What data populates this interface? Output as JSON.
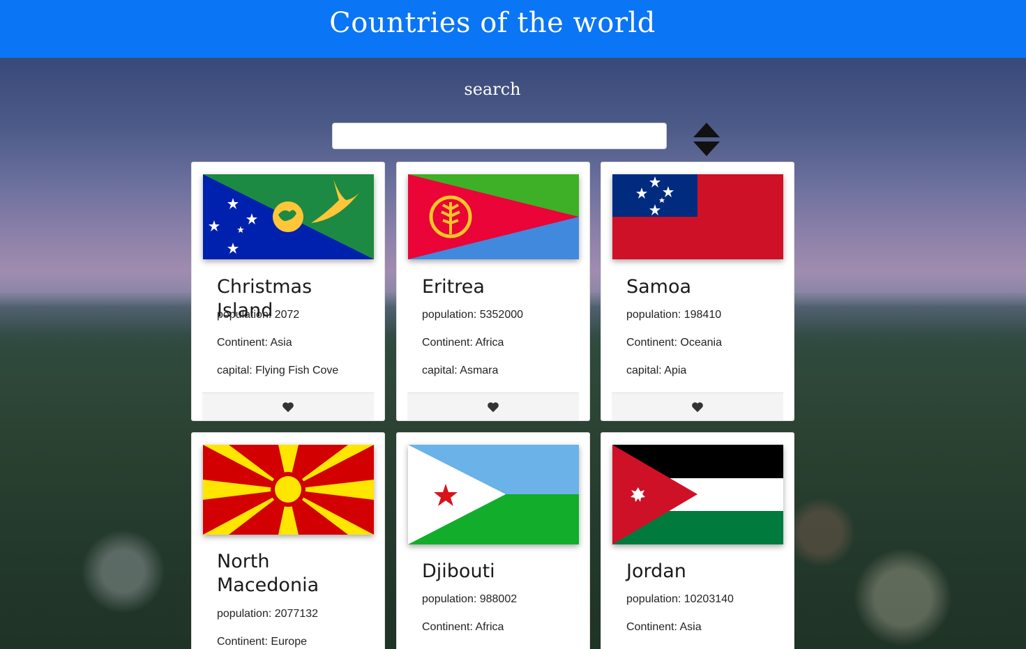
{
  "header": {
    "title": "Countries of the world"
  },
  "search": {
    "label": "search",
    "value": "",
    "placeholder": ""
  },
  "labels": {
    "population": "population: ",
    "continent": "Continent: ",
    "capital": "capital: "
  },
  "colors": {
    "header": "#0a75f5",
    "heart": "#333333"
  },
  "icons": {
    "sort": "sort-icon",
    "favorite": "heart-icon"
  },
  "countries": [
    {
      "name": "Christmas Island",
      "population": "2072",
      "continent": "Asia",
      "capital": "Flying Fish Cove",
      "flag": "christmas-island-flag"
    },
    {
      "name": "Eritrea",
      "population": "5352000",
      "continent": "Africa",
      "capital": "Asmara",
      "flag": "eritrea-flag"
    },
    {
      "name": "Samoa",
      "population": "198410",
      "continent": "Oceania",
      "capital": "Apia",
      "flag": "samoa-flag"
    },
    {
      "name": "North Macedonia",
      "population": "2077132",
      "continent": "Europe",
      "capital": "",
      "flag": "north-macedonia-flag"
    },
    {
      "name": "Djibouti",
      "population": "988002",
      "continent": "Africa",
      "capital": "",
      "flag": "djibouti-flag"
    },
    {
      "name": "Jordan",
      "population": "10203140",
      "continent": "Asia",
      "capital": "",
      "flag": "jordan-flag"
    }
  ]
}
